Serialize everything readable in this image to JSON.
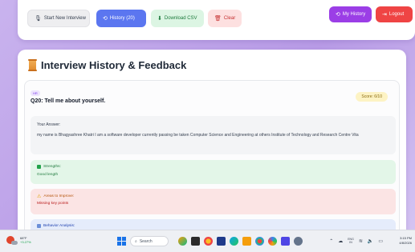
{
  "toolbar": {
    "start_label": "Start New Interview",
    "history_label": "History (20)",
    "csv_label": "Download CSV",
    "clear_label": "Clear",
    "my_history_label": "My History",
    "logout_label": "Logout"
  },
  "main": {
    "title": "Interview History & Feedback",
    "entry": {
      "tag": "HR",
      "question": "Q20: Tell me about yourself.",
      "score": "Score: 6/10",
      "answer_label": "Your Answer:",
      "answer_text": "my name is Bhagyashree Khatri I am a software developer currently passing be taken Computer Science and Engineering at others Institute of Technology and Research Centre Vita",
      "strengths_label": "Strengths:",
      "strengths_text": "Good length",
      "improve_label": "Areas to Improve:",
      "improve_text": "Missing key points",
      "behavior_label": "Behavior Analysis:"
    }
  },
  "taskbar": {
    "weather_temp": "68°F",
    "weather_change": "+3.27%",
    "search_placeholder": "Search",
    "lang_line1": "ENG",
    "lang_line2": "IN",
    "time": "3:15 PM",
    "date": "4/8/2026"
  },
  "colors": {
    "accent_purple": "#9b3ee6",
    "history_blue": "#5b76f0",
    "logout_red": "#ef4444"
  }
}
